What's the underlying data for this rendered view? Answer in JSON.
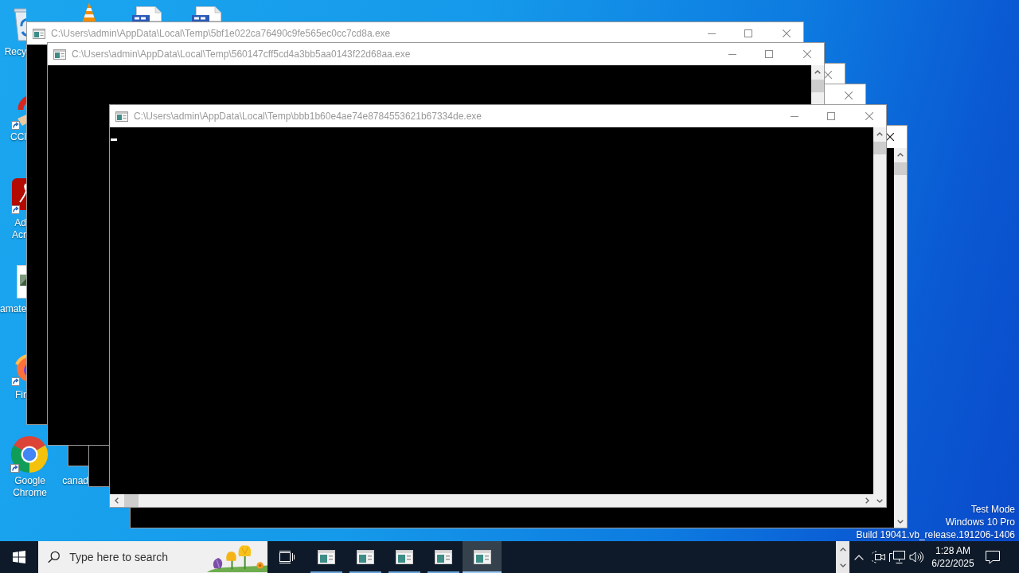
{
  "desktop": {
    "icons": [
      {
        "kind": "recycle_bin",
        "label": "Recy"
      },
      {
        "kind": "cone"
      },
      {
        "kind": "document"
      },
      {
        "kind": "document"
      },
      {
        "kind": "cleaner",
        "label": "CCl"
      },
      {
        "kind": "pdf_app",
        "label": "Ad Acr"
      },
      {
        "kind": "image_file",
        "label": "amate"
      },
      {
        "kind": "fox_browser",
        "label": "Fir"
      },
      {
        "kind": "ring_browser",
        "label": "Google Chrome"
      },
      {
        "label": "canad"
      }
    ],
    "system_text": [
      "Test Mode",
      "Windows 10 Pro",
      "Build 19041.vb_release.191206-1406"
    ]
  },
  "windows": [
    {
      "kind": "console",
      "title": "C:\\Users\\admin\\AppData\\Local\\Temp\\5bf1e022ca76490c9fe565ec0cc7cd8a.exe",
      "focused": false
    },
    {
      "kind": "console",
      "title": "C:\\Users\\admin\\AppData\\Local\\Temp\\560147cff5cd4a3bb5aa0143f22d68aa.exe",
      "focused": false
    },
    {
      "kind": "console",
      "focused": false
    },
    {
      "kind": "console",
      "focused": false
    },
    {
      "kind": "console",
      "title": "C:\\Users\\admin\\AppData\\Local\\Temp\\bbb1b60e4ae74e8784553621b67334de.exe",
      "focused": false,
      "cursor": true,
      "hscroll": true
    },
    {
      "kind": "console",
      "focused": true
    }
  ],
  "taskbar": {
    "search": {
      "placeholder": "Type here to search"
    },
    "apps": [
      {
        "running": true,
        "selected": false
      },
      {
        "running": true,
        "selected": false
      },
      {
        "running": true,
        "selected": false
      },
      {
        "running": true,
        "selected": false
      },
      {
        "running": true,
        "selected": true
      }
    ],
    "clock": {
      "time": "1:28 AM",
      "date": "6/22/2025"
    }
  }
}
